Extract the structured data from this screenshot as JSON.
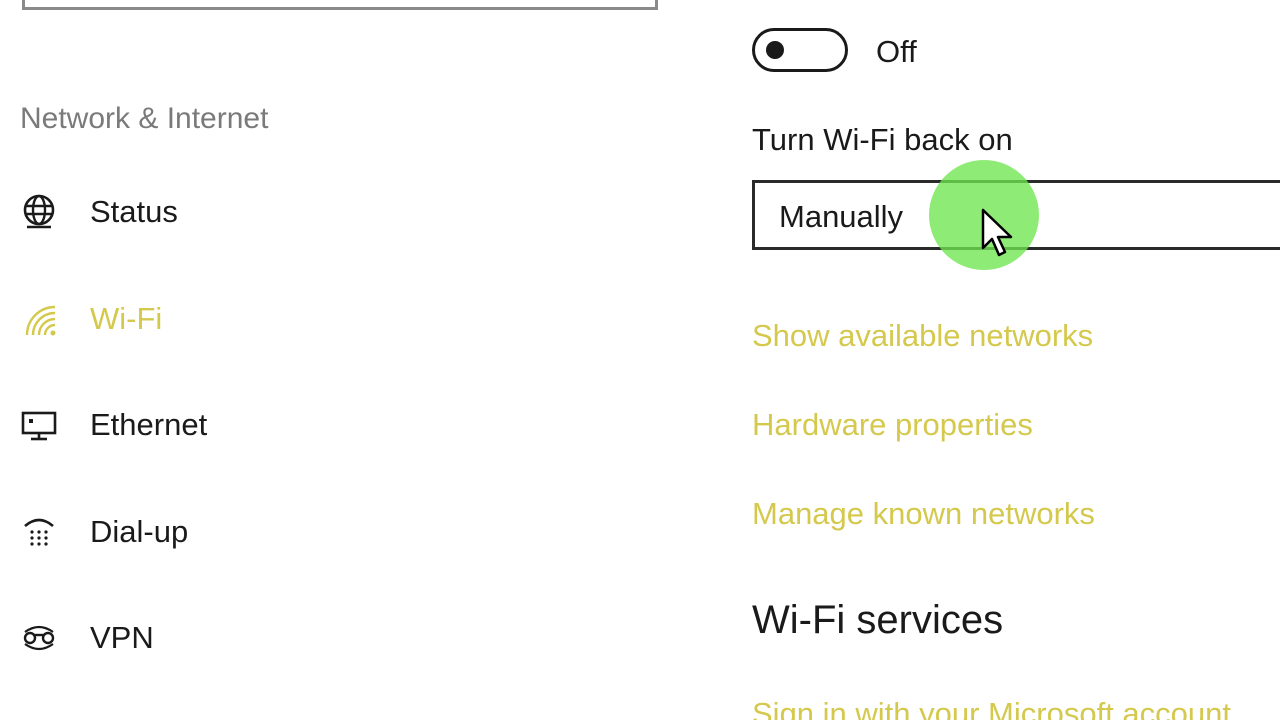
{
  "sidebar": {
    "section_title": "Network & Internet",
    "items": [
      {
        "label": "Status",
        "icon": "globe-icon"
      },
      {
        "label": "Wi-Fi",
        "icon": "wifi-icon",
        "active": true
      },
      {
        "label": "Ethernet",
        "icon": "ethernet-icon"
      },
      {
        "label": "Dial-up",
        "icon": "dialup-icon"
      },
      {
        "label": "VPN",
        "icon": "vpn-icon"
      }
    ]
  },
  "main": {
    "wifi_toggle": {
      "state_label": "Off",
      "on": false
    },
    "turn_back_on": {
      "label": "Turn Wi-Fi back on",
      "selected": "Manually"
    },
    "links": {
      "show_networks": "Show available networks",
      "hardware_properties": "Hardware properties",
      "manage_networks": "Manage known networks"
    },
    "services_heading": "Wi-Fi services",
    "services_link": "Sign in with your Microsoft account"
  },
  "colors": {
    "accent": "#d4c94c",
    "text": "#1a1a1a",
    "muted": "#7a7a7a",
    "click_highlight": "#6ee650"
  }
}
